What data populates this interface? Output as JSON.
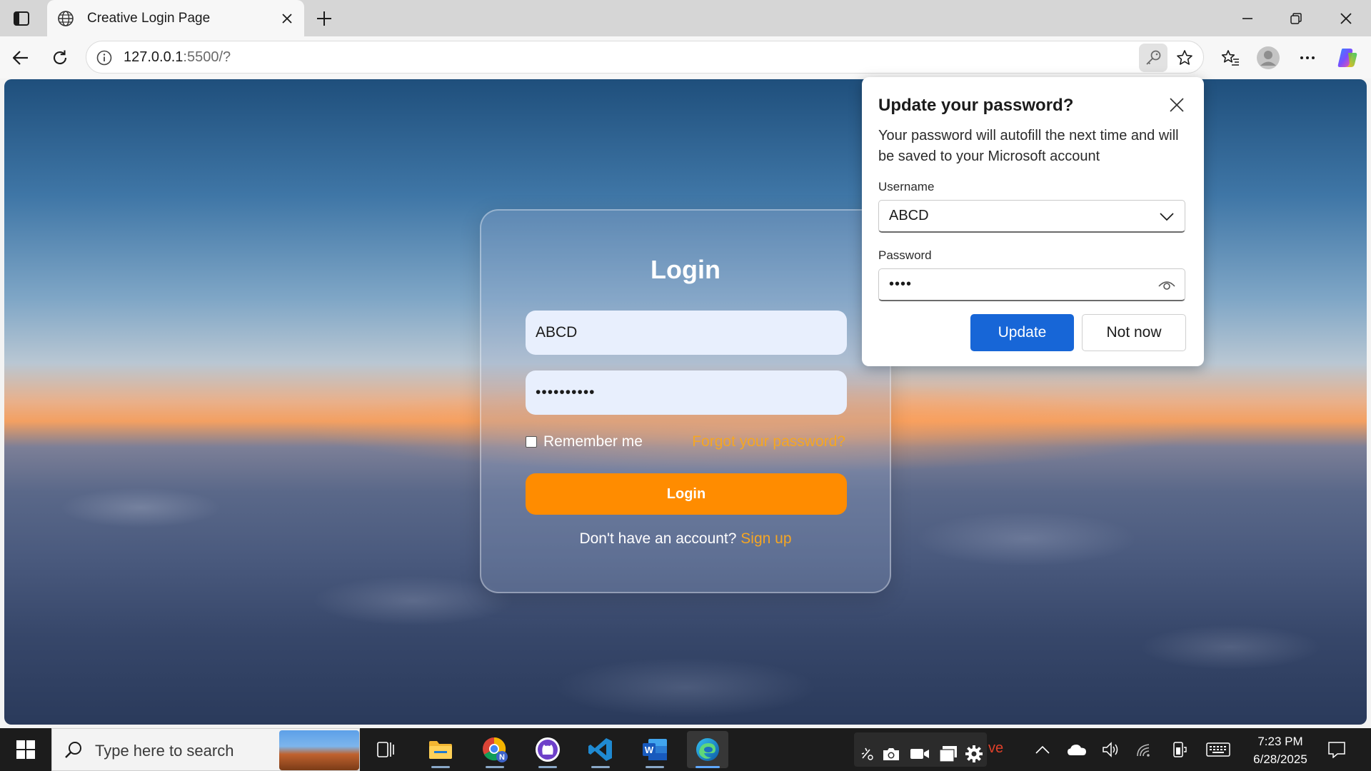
{
  "browser": {
    "tab_title": "Creative Login Page",
    "url_host": "127.0.0.1",
    "url_path": ":5500/?"
  },
  "login": {
    "title": "Login",
    "username_value": "ABCD",
    "password_masked": "••••••••••",
    "remember_label": "Remember me",
    "forgot_link": "Forgot your password?",
    "button_label": "Login",
    "signup_prompt": "Don't have an account?",
    "signup_link": "Sign up"
  },
  "password_popup": {
    "title": "Update your password?",
    "description": "Your password will autofill the next time and will be saved to your Microsoft account",
    "username_label": "Username",
    "username_value": "ABCD",
    "password_label": "Password",
    "password_masked": "••••",
    "update_label": "Update",
    "not_now_label": "Not now"
  },
  "taskbar": {
    "search_placeholder": "Type here to search",
    "tray_text": "ve",
    "time": "7:23 PM",
    "date": "6/28/2025",
    "apps": [
      "task-view",
      "file-explorer",
      "chrome",
      "github-desktop",
      "vscode",
      "word",
      "edge"
    ]
  },
  "colors": {
    "accent_orange": "#ff8c00",
    "link_orange": "#f5a623",
    "update_blue": "#1766d7"
  }
}
